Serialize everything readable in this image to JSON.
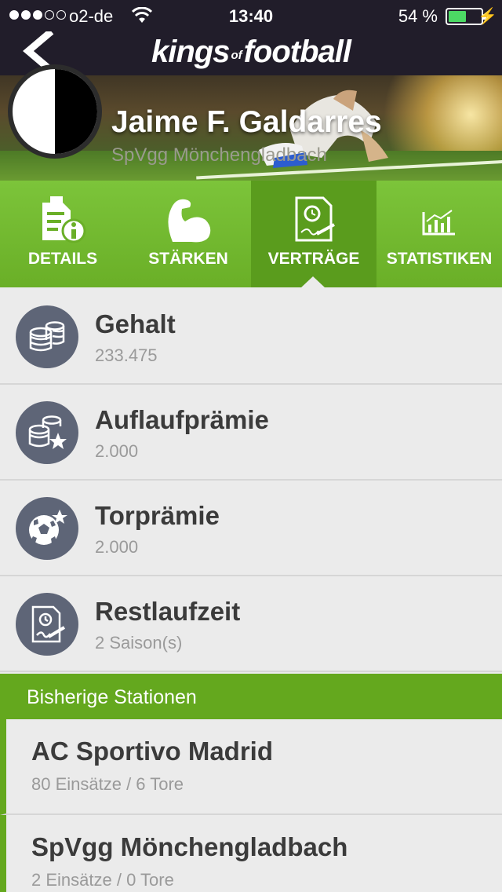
{
  "status_bar": {
    "carrier": "o2-de",
    "time": "13:40",
    "battery_pct": "54 %",
    "battery_level": 0.54
  },
  "header": {
    "brand_kings": "kings",
    "brand_of": "of",
    "brand_football": "football"
  },
  "player": {
    "name": "Jaime F. Galdarres",
    "club": "SpVgg Mönchengladbach"
  },
  "tabs": [
    {
      "label": "DETAILS",
      "icon": "details-icon"
    },
    {
      "label": "STÄRKEN",
      "icon": "muscle-icon"
    },
    {
      "label": "VERTRÄGE",
      "icon": "contract-icon",
      "active": true
    },
    {
      "label": "STATISTIKEN",
      "icon": "statistics-icon"
    }
  ],
  "contract": [
    {
      "title": "Gehalt",
      "value": "233.475",
      "icon": "coins-icon"
    },
    {
      "title": "Auflaufprämie",
      "value": "2.000",
      "icon": "coins-star-icon"
    },
    {
      "title": "Torprämie",
      "value": "2.000",
      "icon": "ball-star-icon"
    },
    {
      "title": "Restlaufzeit",
      "value": "2 Saison(s)",
      "icon": "contract-clock-icon"
    }
  ],
  "stations_header": "Bisherige Stationen",
  "stations": [
    {
      "club": "AC Sportivo Madrid",
      "stats": "80 Einsätze / 6 Tore"
    },
    {
      "club": "SpVgg Mönchengladbach",
      "stats": "2 Einsätze / 0 Tore"
    }
  ],
  "colors": {
    "nav_bg": "#211d2a",
    "accent_green": "#6aaf27",
    "icon_circle": "#5e6577",
    "battery_green": "#4cd964"
  }
}
